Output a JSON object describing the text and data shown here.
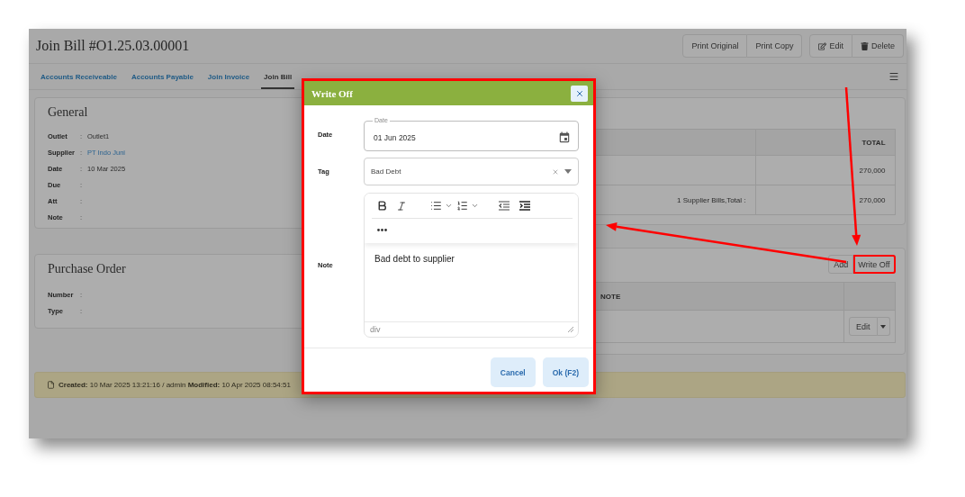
{
  "header": {
    "title": "Join Bill #O1.25.03.00001",
    "button_groups": [
      [
        {
          "kind": "print",
          "label": "Print Original"
        },
        {
          "kind": "print",
          "label": "Print Copy"
        }
      ],
      [
        {
          "kind": "edit",
          "label": "Edit"
        },
        {
          "kind": "delete",
          "label": "Delete"
        }
      ]
    ]
  },
  "tabs": [
    {
      "label": "Accounts Receiveable",
      "selected": false
    },
    {
      "label": "Accounts Payable",
      "selected": false
    },
    {
      "label": "Join Invoice",
      "selected": false
    },
    {
      "label": "Join Bill",
      "selected": true
    }
  ],
  "general": {
    "title": "General",
    "fields": [
      {
        "label": "Outlet",
        "separator": ":",
        "value": "Outlet1",
        "link": false
      },
      {
        "label": "Supplier",
        "separator": ":",
        "value": "PT Indo Juni",
        "link": true
      },
      {
        "label": "Date",
        "separator": ":",
        "value": "10 Mar 2025",
        "link": false
      },
      {
        "label": "Due",
        "separator": ":"
      },
      {
        "label": "Att",
        "separator": ":"
      },
      {
        "label": "Note",
        "separator": ":"
      }
    ]
  },
  "purchase_order": {
    "title": "Purchase Order",
    "fields": [
      {
        "label": "Number",
        "separator": ":"
      },
      {
        "label": "Type",
        "separator": ":"
      }
    ]
  },
  "totals_table": {
    "total_header": "TOTAL",
    "rows": [
      {
        "total": "270,000"
      },
      {
        "summary": "1 Supplier Bills,Total :",
        "total": "270,000"
      }
    ]
  },
  "notes": {
    "buttons": [
      {
        "label": "Add",
        "highlighted": false
      },
      {
        "label": "Write Off",
        "highlighted": true
      }
    ],
    "note_header": "NOTE",
    "rows": [
      {
        "action": "Edit"
      }
    ]
  },
  "audit": "**Created:** 10 Mar 2025 13:21:16 / admin **Modified:** 10 Apr 2025 08:54:51",
  "dialog": {
    "title": "Write Off",
    "highlighted": true,
    "fields": [
      {
        "kind": "date",
        "label": "Date",
        "floating_label": "Date",
        "value": "01 Jun 2025"
      },
      {
        "kind": "select",
        "label": "Tag",
        "value": "Bad Debt"
      },
      {
        "kind": "editor",
        "label": "Note",
        "value": "Bad debt to supplier",
        "status": "div"
      }
    ],
    "buttons": [
      {
        "label": "Cancel"
      },
      {
        "label": "Ok (F2)"
      }
    ]
  }
}
